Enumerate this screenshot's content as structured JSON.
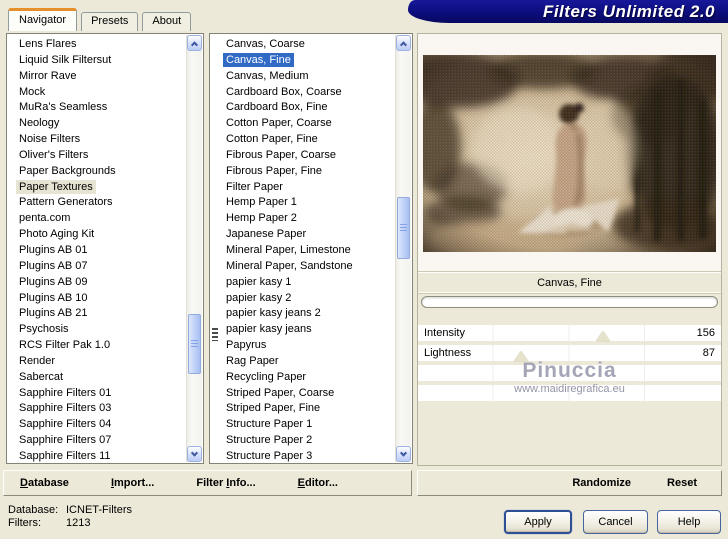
{
  "window": {
    "title": "Filters Unlimited 2.0"
  },
  "tabs": [
    {
      "label": "Navigator",
      "active": true
    },
    {
      "label": "Presets",
      "active": false
    },
    {
      "label": "About",
      "active": false
    }
  ],
  "navigator_list": {
    "items": [
      "Lens Flares",
      "Liquid Silk Filtersut",
      "Mirror Rave",
      "Mock",
      "MuRa's Seamless",
      "Neology",
      "Noise Filters",
      "Oliver's Filters",
      "Paper Backgrounds",
      "Paper Textures",
      "Pattern Generators",
      "penta.com",
      "Photo Aging Kit",
      "Plugins AB 01",
      "Plugins AB 07",
      "Plugins AB 09",
      "Plugins AB 10",
      "Plugins AB 21",
      "Psychosis",
      "RCS Filter Pak 1.0",
      "Render",
      "Sabercat",
      "Sapphire Filters 01",
      "Sapphire Filters 03",
      "Sapphire Filters 04",
      "Sapphire Filters 07",
      "Sapphire Filters 11"
    ],
    "selected_index": 9,
    "selected_item": "Paper Textures"
  },
  "filter_list": {
    "items": [
      "Canvas, Coarse",
      "Canvas, Fine",
      "Canvas, Medium",
      "Cardboard Box, Coarse",
      "Cardboard Box, Fine",
      "Cotton Paper, Coarse",
      "Cotton Paper, Fine",
      "Fibrous Paper, Coarse",
      "Fibrous Paper, Fine",
      "Filter Paper",
      "Hemp Paper 1",
      "Hemp Paper 2",
      "Japanese Paper",
      "Mineral Paper, Limestone",
      "Mineral Paper, Sandstone",
      "papier kasy 1",
      "papier kasy 2",
      "papier kasy jeans 2",
      "papier kasy jeans",
      "Papyrus",
      "Rag Paper",
      "Recycling Paper",
      "Striped Paper, Coarse",
      "Striped Paper, Fine",
      "Structure Paper 1",
      "Structure Paper 2",
      "Structure Paper 3"
    ],
    "selected_index": 1,
    "selected_item": "Canvas, Fine"
  },
  "preview": {
    "caption": "Canvas, Fine"
  },
  "sliders": [
    {
      "label": "Intensity",
      "value": "156",
      "percent": 61
    },
    {
      "label": "Lightness",
      "value": "87",
      "percent": 34
    }
  ],
  "watermark": {
    "line1": "Pinuccia",
    "line2": "www.maidiregrafica.eu"
  },
  "toolbar": {
    "left": [
      {
        "pre": "",
        "accel": "D",
        "post": "atabase"
      },
      {
        "pre": "",
        "accel": "I",
        "post": "mport..."
      },
      {
        "pre": "Filter ",
        "accel": "I",
        "post": "nfo..."
      },
      {
        "pre": "",
        "accel": "E",
        "post": "ditor..."
      }
    ],
    "right": [
      "Randomize",
      "Reset"
    ]
  },
  "status": {
    "database_label": "Database:",
    "database_value": "ICNET-Filters",
    "filters_label": "Filters:",
    "filters_value": "1213"
  },
  "actions": {
    "apply": "Apply",
    "cancel": "Cancel",
    "help": "Help"
  },
  "colors": {
    "dialog_bg": "#ECE9D8",
    "titlebar_blue": "#0C0D7C",
    "selection_blue": "#316AC5",
    "selection_soft": "#E8E4D3",
    "tab_accent_orange": "#E5902A"
  }
}
